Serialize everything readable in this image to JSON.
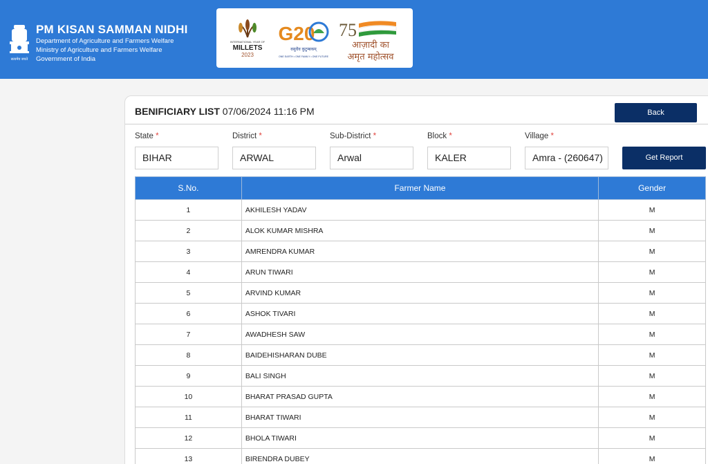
{
  "header": {
    "title": "PM KISAN SAMMAN NIDHI",
    "line1": "Department of Agriculture and Farmers Welfare",
    "line2": "Ministry of Agriculture and Farmers Welfare",
    "line3": "Government of India",
    "emblem_motto": "सत्यमेव जयते",
    "logos": {
      "millets_top": "INTERNATIONAL YEAR OF",
      "millets_word": "MILLETS",
      "millets_year": "2023",
      "g20_word": "G20",
      "g20_sub": "वसुधैव कुटुम्बकम्",
      "g20_tagline": "ONE EARTH • ONE FAMILY • ONE FUTURE",
      "aka_number": "75",
      "aka_line1": "आज़ादी का",
      "aka_line2": "अमृत महोत्सव"
    }
  },
  "panel": {
    "heading_bold": "BENIFICIARY LIST",
    "heading_time": "07/06/2024 11:16 PM",
    "back_label": "Back",
    "report_label": "Get Report"
  },
  "filters": {
    "state": {
      "label": "State",
      "required": "*",
      "value": "BIHAR"
    },
    "district": {
      "label": "District",
      "required": "*",
      "value": "ARWAL"
    },
    "subdistrict": {
      "label": "Sub-District",
      "required": "*",
      "value": "Arwal"
    },
    "block": {
      "label": "Block",
      "required": "*",
      "value": "KALER"
    },
    "village": {
      "label": "Village",
      "required": "*",
      "value": "Amra - (260647)"
    }
  },
  "table": {
    "columns": [
      "S.No.",
      "Farmer Name",
      "Gender"
    ],
    "rows": [
      [
        "1",
        "AKHILESH YADAV",
        "M"
      ],
      [
        "2",
        "ALOK KUMAR MISHRA",
        "M"
      ],
      [
        "3",
        "AMRENDRA KUMAR",
        "M"
      ],
      [
        "4",
        "ARUN TIWARI",
        "M"
      ],
      [
        "5",
        "ARVIND KUMAR",
        "M"
      ],
      [
        "6",
        "ASHOK TIVARI",
        "M"
      ],
      [
        "7",
        "AWADHESH SAW",
        "M"
      ],
      [
        "8",
        "BAIDEHISHARAN DUBE",
        "M"
      ],
      [
        "9",
        "BALI SINGH",
        "M"
      ],
      [
        "10",
        "BHARAT PRASAD GUPTA",
        "M"
      ],
      [
        "11",
        "BHARAT TIWARI",
        "M"
      ],
      [
        "12",
        "BHOLA TIWARI",
        "M"
      ],
      [
        "13",
        "BIRENDRA DUBEY",
        "M"
      ]
    ]
  },
  "colors": {
    "header_blue": "#2e7ad6",
    "button_navy": "#0b2f66",
    "required_red": "#e0443e"
  }
}
